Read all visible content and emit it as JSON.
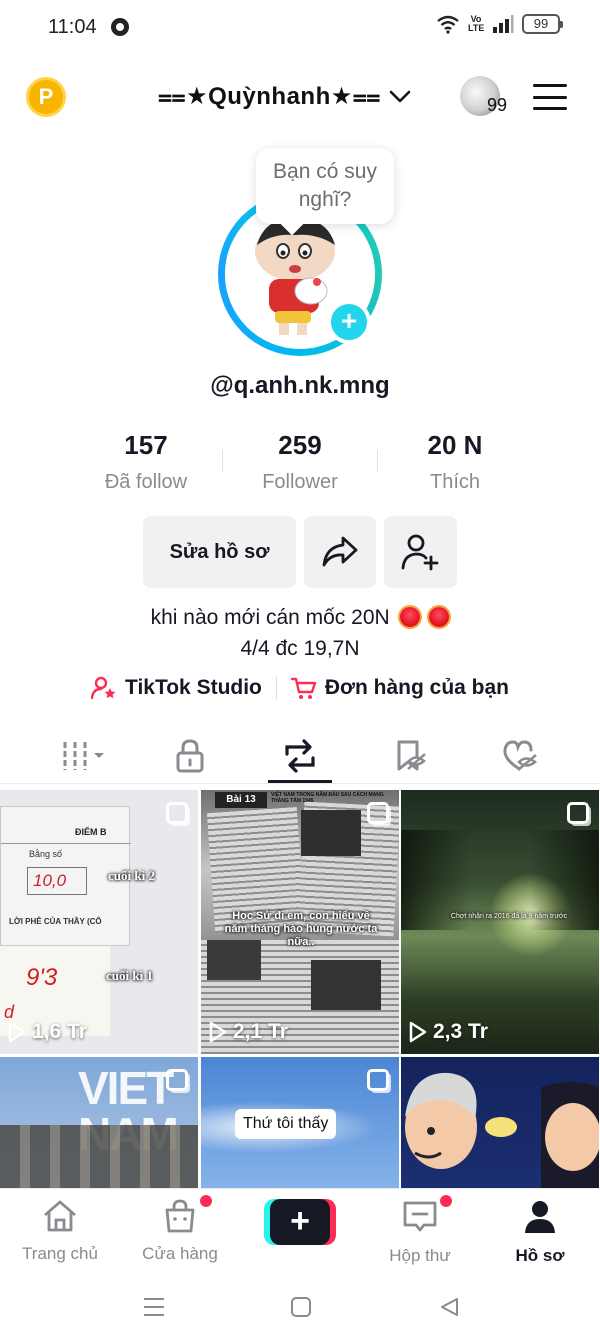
{
  "status_bar": {
    "time": "11:04",
    "network": "Vo LTE",
    "battery": "99"
  },
  "header": {
    "username": "⩵★Quỳnhanh★⩵",
    "notification_count": "99"
  },
  "profile": {
    "bubble_text": "Bạn có suy nghĩ?",
    "handle": "@q.anh.nk.mng",
    "stats": [
      {
        "value": "157",
        "label": "Đã follow"
      },
      {
        "value": "259",
        "label": "Follower"
      },
      {
        "value": "20 N",
        "label": "Thích"
      }
    ],
    "edit_button": "Sửa hồ sơ",
    "bio_line1": "khi nào mới cán mốc  20N",
    "bio_line2": "4/4 đc 19,7N",
    "links": [
      {
        "label": "TikTok Studio",
        "icon": "person-star-icon"
      },
      {
        "label": "Đơn hàng của bạn",
        "icon": "cart-icon"
      }
    ]
  },
  "tabs": [
    {
      "icon": "grid-sort-icon",
      "active": false
    },
    {
      "icon": "lock-icon",
      "active": false
    },
    {
      "icon": "repost-icon",
      "active": true
    },
    {
      "icon": "bookmark-hidden-icon",
      "active": false
    },
    {
      "icon": "heart-hidden-icon",
      "active": false
    }
  ],
  "videos": [
    {
      "views": "1,6 Tr",
      "captions": [
        "cuối kì 2",
        "cuối kì 1"
      ],
      "texts": [
        "ĐIỂM B",
        "Bằng số",
        "10,0",
        "LỜI PHÊ CỦA THẦY (CÔ",
        "9'3",
        "d"
      ]
    },
    {
      "views": "2,1 Tr",
      "captions": [
        "Học Sử đi em, con hiểu về năm tháng hào hùng nước ta nữa.."
      ],
      "texts": [
        "Bài 13",
        "VIỆT NAM TRONG NĂM ĐẦU SAU CÁCH MẠNG THÁNG TÁM 1945"
      ]
    },
    {
      "views": "2,3 Tr",
      "captions": [
        "Chợt nhận ra 2016 đã là 9 năm trước"
      ]
    },
    {
      "views": "",
      "captions": [
        "VIET NAM"
      ]
    },
    {
      "views": "",
      "captions": [
        "Thứ tôi thấy"
      ]
    },
    {
      "views": "",
      "captions": []
    }
  ],
  "bottom_nav": [
    {
      "label": "Trang chủ",
      "icon": "home-icon"
    },
    {
      "label": "Cửa hàng",
      "icon": "shop-bag-icon",
      "dot": true
    },
    {
      "label": "",
      "icon": "create-plus-icon"
    },
    {
      "label": "Hộp thư",
      "icon": "inbox-icon",
      "dot": true
    },
    {
      "label": "Hồ sơ",
      "icon": "profile-icon",
      "active": true
    }
  ],
  "colors": {
    "accent_red": "#fe2c55",
    "accent_cyan": "#25f4ee",
    "text_primary": "#161823",
    "text_secondary": "#8a8b91"
  }
}
